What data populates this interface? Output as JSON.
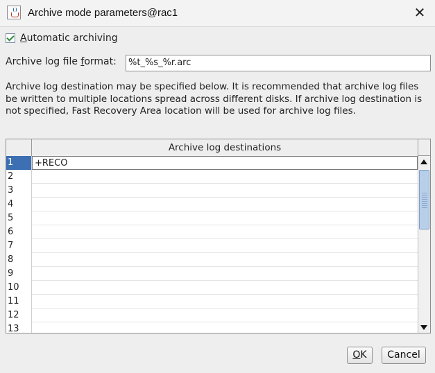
{
  "window": {
    "title": "Archive mode parameters@rac1",
    "close_glyph": "✕"
  },
  "auto_archiving": {
    "mnemonic": "A",
    "label_rest": "utomatic archiving",
    "checked": true
  },
  "format": {
    "label_pre": "Archive log file ",
    "mnemonic": "f",
    "label_post": "ormat:",
    "value": "%t_%s_%r.arc"
  },
  "description": "Archive log destination may be specified below. It is recommended that archive log files be written to multiple locations spread across different disks. If archive log destination is not specified, Fast Recovery Area location will be used for archive log files.",
  "table": {
    "column_header": "Archive log destinations",
    "rows": [
      {
        "num": "1",
        "value": "+RECO"
      },
      {
        "num": "2",
        "value": ""
      },
      {
        "num": "3",
        "value": ""
      },
      {
        "num": "4",
        "value": ""
      },
      {
        "num": "5",
        "value": ""
      },
      {
        "num": "6",
        "value": ""
      },
      {
        "num": "7",
        "value": ""
      },
      {
        "num": "8",
        "value": ""
      },
      {
        "num": "9",
        "value": ""
      },
      {
        "num": "10",
        "value": ""
      },
      {
        "num": "11",
        "value": ""
      },
      {
        "num": "12",
        "value": ""
      },
      {
        "num": "13",
        "value": ""
      }
    ],
    "selected_row": "1"
  },
  "buttons": {
    "ok_mnemonic": "O",
    "ok_rest": "K",
    "cancel": "Cancel"
  },
  "colors": {
    "selection": "#3d6fb3",
    "check": "#2e8b3a",
    "scroll_thumb": "#b8cfea"
  }
}
